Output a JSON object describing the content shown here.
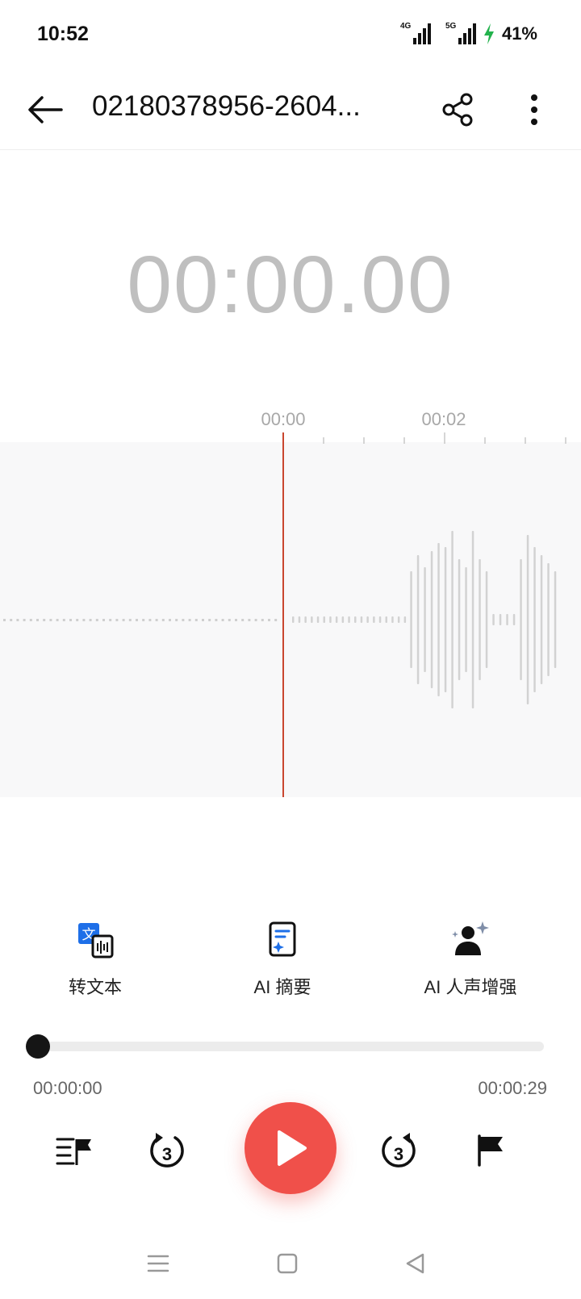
{
  "status_bar": {
    "time": "10:52",
    "signal_1_tag": "4G",
    "signal_2_tag": "5G",
    "battery_percent": "41%"
  },
  "app_bar": {
    "title": "02180378956-2604...",
    "back_icon": "arrow-left-icon",
    "share_icon": "share-icon",
    "more_icon": "more-vertical-icon"
  },
  "player": {
    "elapsed_display": "00:00.00",
    "current_time": "00:00:00",
    "total_time": "00:00:29",
    "progress_fraction": 0.0
  },
  "timeline": {
    "tick_labels": [
      "00:00",
      "00:02"
    ]
  },
  "quick_actions": [
    {
      "label": "转文本",
      "icon": "speech-to-text-icon"
    },
    {
      "label": "AI 摘要",
      "icon": "ai-summary-icon"
    },
    {
      "label": "AI 人声增强",
      "icon": "ai-voice-enhance-icon"
    }
  ],
  "controls": {
    "mark_list_icon": "mark-list-icon",
    "rewind_icon": "rewind-3s-icon",
    "rewind_label": "3",
    "play_icon": "play-icon",
    "forward_icon": "forward-3s-icon",
    "forward_label": "3",
    "flag_icon": "flag-icon"
  },
  "colors": {
    "accent": "#f0504a",
    "playhead": "#c9462f",
    "wave_bar": "#d2d2d2",
    "timer_text": "#bfbfbf",
    "text_icon_accent": "#1e6fe8"
  }
}
